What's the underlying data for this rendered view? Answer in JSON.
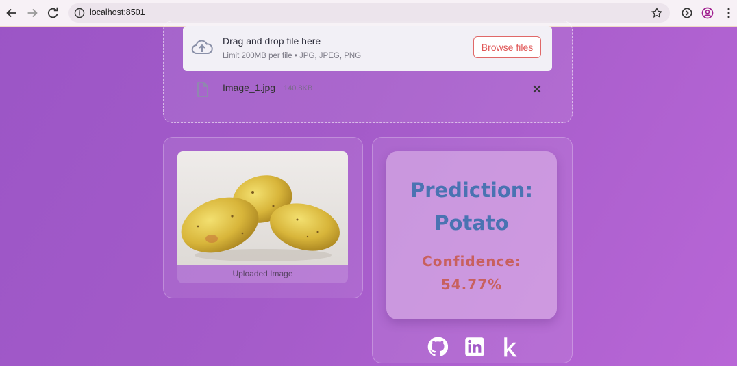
{
  "browser": {
    "url": "localhost:8501"
  },
  "uploader": {
    "title": "Drag and drop file here",
    "limit": "Limit 200MB per file • JPG, JPEG, PNG",
    "browse_label": "Browse files",
    "file_name": "Image_1.jpg",
    "file_size": "140.8KB"
  },
  "image_card": {
    "caption": "Uploaded Image"
  },
  "result": {
    "prediction_label": "Prediction:",
    "prediction_value": "Potato",
    "confidence_label": "Confidence:",
    "confidence_value": "54.77%"
  },
  "social_icons": [
    "github-icon",
    "linkedin-icon",
    "kaggle-icon"
  ],
  "colors": {
    "prediction": "#4a73b2",
    "confidence": "#c8605e",
    "browse_accent": "#e05656"
  }
}
